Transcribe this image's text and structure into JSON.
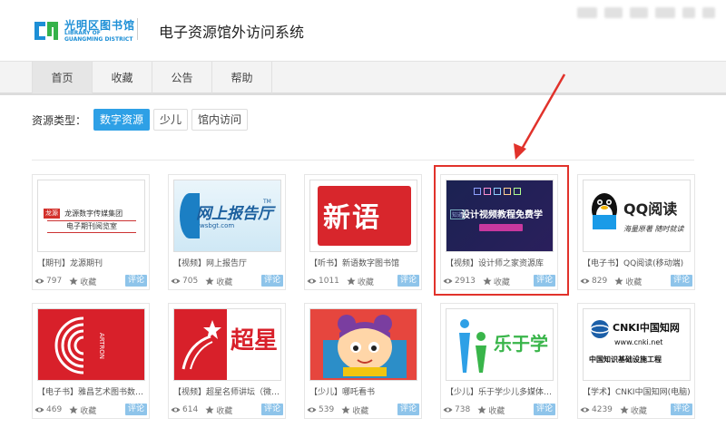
{
  "header": {
    "logo_cn": "光明区图书馆",
    "logo_en_line1": "LIBRARY OF",
    "logo_en_line2": "GUANGMING DISTRICT",
    "system_title": "电子资源馆外访问系统"
  },
  "nav": {
    "items": [
      {
        "label": "首页",
        "active": true
      },
      {
        "label": "收藏",
        "active": false
      },
      {
        "label": "公告",
        "active": false
      },
      {
        "label": "帮助",
        "active": false
      }
    ]
  },
  "filter": {
    "label": "资源类型：",
    "options": [
      {
        "label": "数字资源",
        "active": true
      },
      {
        "label": "少儿",
        "active": false
      },
      {
        "label": "馆内访问",
        "active": false
      }
    ]
  },
  "cards": [
    {
      "title": "【期刊】龙源期刊",
      "views": "797",
      "fav": "收藏",
      "comment": "评论",
      "thumb_text": "龙源数字传媒集团",
      "thumb_sub": "电子期刊阅览室",
      "thumb_badge": "龙源"
    },
    {
      "title": "【视频】网上报告厅",
      "views": "705",
      "fav": "收藏",
      "comment": "评论",
      "thumb_text": "网上报告厅",
      "thumb_sub": "wsbgt.com",
      "thumb_badge": "TM"
    },
    {
      "title": "【听书】新语数字图书馆",
      "views": "1011",
      "fav": "收藏",
      "comment": "评论",
      "thumb_text": "新语"
    },
    {
      "title": "【视频】设计师之家资源库",
      "views": "2913",
      "fav": "收藏",
      "comment": "评论",
      "thumb_text": "设计视频教程免费学",
      "thumb_sub": "知道"
    },
    {
      "title": "【电子书】QQ阅读(移动端)",
      "views": "829",
      "fav": "收藏",
      "comment": "评论",
      "thumb_text": "QQ阅读",
      "thumb_sub": "海量原著 随时就读"
    },
    {
      "title": "【电子书】雅昌艺术图书数据...",
      "views": "469",
      "fav": "收藏",
      "comment": "评论",
      "thumb_text": "ARTRON"
    },
    {
      "title": "【视频】超星名师讲坛（微信...",
      "views": "614",
      "fav": "收藏",
      "comment": "评论",
      "thumb_text": "超星"
    },
    {
      "title": "【少儿】哪吒看书",
      "views": "539",
      "fav": "收藏",
      "comment": "评论"
    },
    {
      "title": "【少儿】乐于学少儿多媒体图...",
      "views": "738",
      "fav": "收藏",
      "comment": "评论",
      "thumb_text": "乐于学"
    },
    {
      "title": "【学术】CNKI中国知网(电脑)",
      "views": "4239",
      "fav": "收藏",
      "comment": "评论",
      "thumb_text": "CNKI中国知网",
      "thumb_sub": "www.cnki.net",
      "thumb_sub2": "中国知识基础设施工程"
    }
  ],
  "colors": {
    "accent": "#2ea0e6",
    "highlight": "#e1322b",
    "comment_button": "#8ec4ea"
  }
}
